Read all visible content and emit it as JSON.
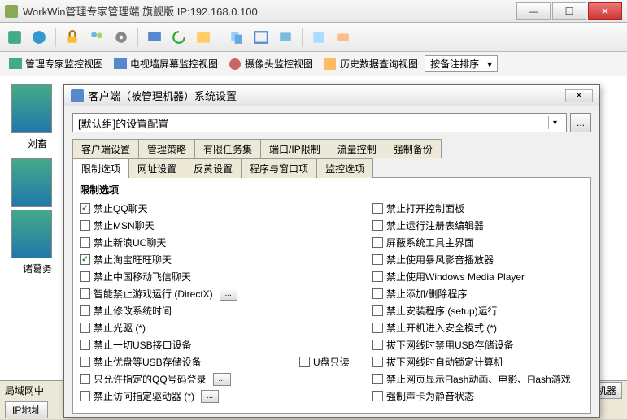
{
  "window": {
    "title": "WorkWin管理专家管理端  旗舰版 IP:192.168.0.100"
  },
  "views": {
    "v1": "管理专家监控视图",
    "v2": "电视墙屏幕监控视图",
    "v3": "摄像头监控视图",
    "v4": "历史数据查询视图",
    "sort": "按备注排序"
  },
  "thumbs": {
    "t1": "刘畜",
    "t2": "诸葛务"
  },
  "status": {
    "lan": "局域网中",
    "ip_btn": "IP地址",
    "right": "监视机器"
  },
  "dialog": {
    "title": "客户端（被管理机器）系统设置",
    "combo": "[默认组]的设置配置",
    "tabs1": {
      "a": "客户端设置",
      "b": "管理策略",
      "c": "有限任务集",
      "d": "端口/IP限制",
      "e": "流量控制",
      "f": "强制备份"
    },
    "tabs2": {
      "a": "限制选项",
      "b": "网址设置",
      "c": "反黄设置",
      "d": "程序与窗口项",
      "e": "监控选项"
    },
    "group_title": "限制选项",
    "left": [
      {
        "label": "禁止QQ聊天",
        "checked": true
      },
      {
        "label": "禁止MSN聊天",
        "checked": false
      },
      {
        "label": "禁止新浪UC聊天",
        "checked": false
      },
      {
        "label": "禁止淘宝旺旺聊天",
        "checked": true
      },
      {
        "label": "禁止中国移动飞信聊天",
        "checked": false
      },
      {
        "label": "智能禁止游戏运行 (DirectX)",
        "checked": false,
        "btn": true
      },
      {
        "label": "禁止修改系统时间",
        "checked": false
      },
      {
        "label": "禁止光驱 (*)",
        "checked": false
      },
      {
        "label": "禁止一切USB接口设备",
        "checked": false
      },
      {
        "label": "禁止优盘等USB存储设备",
        "checked": false
      },
      {
        "label": "只允许指定的QQ号码登录",
        "checked": false,
        "btn": true
      },
      {
        "label": "禁止访问指定驱动器 (*)",
        "checked": false,
        "btn": true
      }
    ],
    "mid": {
      "label": "U盘只读",
      "checked": false
    },
    "right": [
      {
        "label": "禁止打开控制面板",
        "checked": false
      },
      {
        "label": "禁止运行注册表编辑器",
        "checked": false
      },
      {
        "label": "屏蔽系统工具主界面",
        "checked": false
      },
      {
        "label": "禁止使用暴风影音播放器",
        "checked": false
      },
      {
        "label": "禁止使用Windows Media Player",
        "checked": false
      },
      {
        "label": "禁止添加/删除程序",
        "checked": false
      },
      {
        "label": "禁止安装程序 (setup)运行",
        "checked": false
      },
      {
        "label": "禁止开机进入安全模式 (*)",
        "checked": false
      },
      {
        "label": "拔下网线时禁用USB存储设备",
        "checked": false
      },
      {
        "label": "拔下网线时自动锁定计算机",
        "checked": false
      },
      {
        "label": "禁止网页显示Flash动画、电影、Flash游戏",
        "checked": false
      },
      {
        "label": "强制声卡为静音状态",
        "checked": false
      }
    ]
  }
}
